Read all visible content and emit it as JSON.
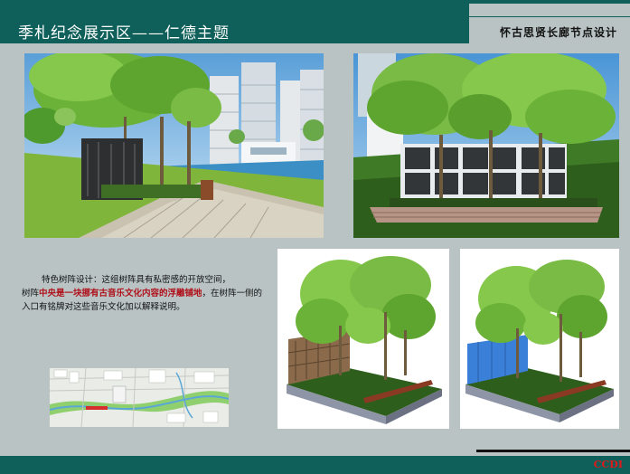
{
  "header": {
    "title": "季札纪念展示区——仁德主题",
    "subtitle": "怀古思贤长廊节点设计"
  },
  "caption": {
    "line1": "特色树阵设计：这组树阵具有私密感的开放空间，",
    "prefix": "树阵",
    "highlight": "中央是一块挪有古音乐文化内容的浮雕铺地",
    "suffix": "，在树阵一侧的入口有铭牌对这些音乐文化加以解释说明。"
  },
  "brand": "CCDI",
  "icons": {
    "scene1": "park-riverside-render",
    "scene2": "tree-array-relief-wall-render",
    "scene3": "tree-array-model-brown-wall",
    "scene4": "tree-array-model-blue-wall",
    "map": "site-location-map"
  },
  "colors": {
    "header": "#0f5f5a",
    "background": "#b9c3c3",
    "highlight": "#b0101a",
    "brand": "#e01a1a"
  }
}
